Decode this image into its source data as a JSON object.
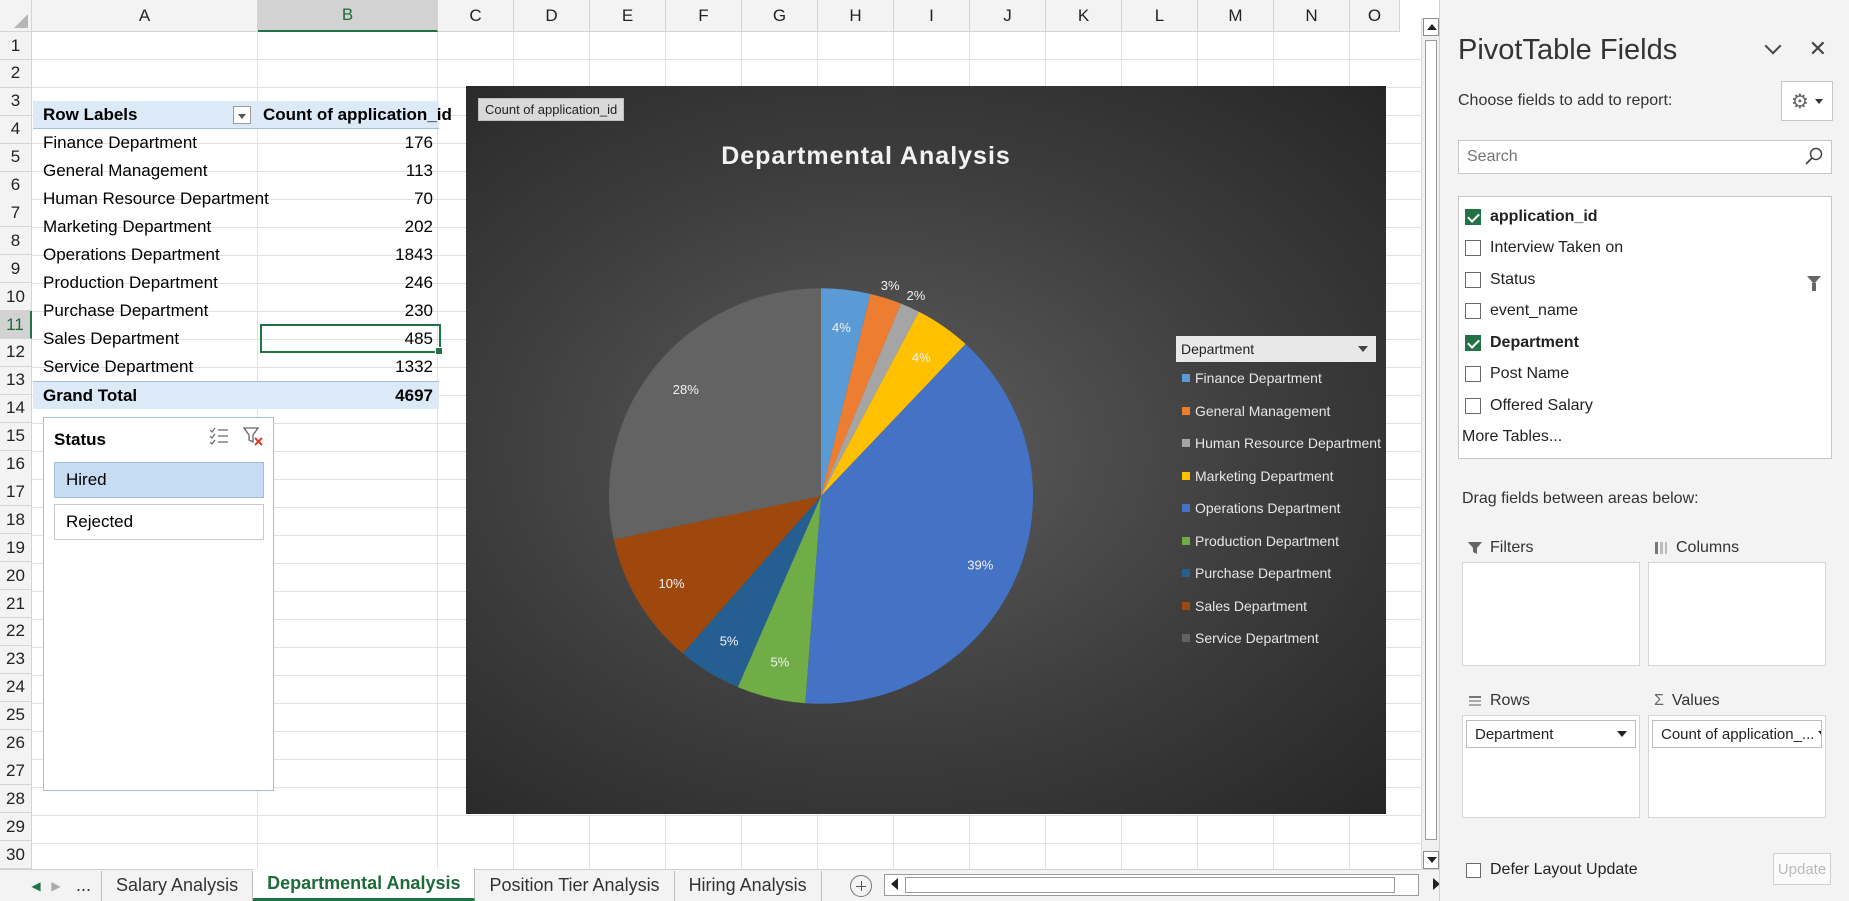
{
  "sheet": {
    "columns": [
      "A",
      "B",
      "C",
      "D",
      "E",
      "F",
      "G",
      "H",
      "I",
      "J",
      "K",
      "L",
      "M",
      "N",
      "O"
    ],
    "selected_column": "B",
    "rows": [
      "1",
      "2",
      "3",
      "4",
      "5",
      "6",
      "7",
      "8",
      "9",
      "10",
      "11",
      "12",
      "13",
      "14",
      "15",
      "16",
      "17",
      "18",
      "19",
      "20",
      "21",
      "22",
      "23",
      "24",
      "25",
      "26",
      "27",
      "28",
      "29",
      "30"
    ],
    "selected_row": "11"
  },
  "pivot": {
    "header_label": "Row Labels",
    "header_value": "Count of application_id",
    "rows": [
      {
        "label": "Finance Department",
        "value": "176"
      },
      {
        "label": "General Management",
        "value": "113"
      },
      {
        "label": "Human Resource Department",
        "value": "70"
      },
      {
        "label": "Marketing Department",
        "value": "202"
      },
      {
        "label": "Operations Department",
        "value": "1843"
      },
      {
        "label": "Production Department",
        "value": "246"
      },
      {
        "label": "Purchase Department",
        "value": "230"
      },
      {
        "label": "Sales Department",
        "value": "485"
      },
      {
        "label": "Service Department",
        "value": "1332"
      }
    ],
    "total_label": "Grand Total",
    "total_value": "4697"
  },
  "slicer": {
    "title": "Status",
    "items": [
      {
        "label": "Hired",
        "selected": true
      },
      {
        "label": "Rejected",
        "selected": false
      }
    ]
  },
  "chart_data": {
    "type": "pie",
    "title": "Departmental Analysis",
    "value_field_button": "Count of application_id",
    "legend_title": "Department",
    "legend_position": "right",
    "categories": [
      "Finance Department",
      "General Management",
      "Human Resource Department",
      "Marketing Department",
      "Operations Department",
      "Production Department",
      "Purchase Department",
      "Sales Department",
      "Service Department"
    ],
    "values": [
      176,
      113,
      70,
      202,
      1843,
      246,
      230,
      485,
      1332
    ],
    "labels": [
      "4%",
      "3%",
      "2%",
      "4%",
      "39%",
      "5%",
      "5%",
      "10%",
      "28%"
    ],
    "colors": [
      "#5b9bd5",
      "#ed7d31",
      "#a5a5a5",
      "#ffc000",
      "#4472c4",
      "#70ad47",
      "#255e91",
      "#9e480e",
      "#636363"
    ]
  },
  "tabs": {
    "ellipsis": "...",
    "items": [
      {
        "label": "Salary Analysis",
        "active": false
      },
      {
        "label": "Departmental Analysis",
        "active": true
      },
      {
        "label": "Position Tier Analysis",
        "active": false
      },
      {
        "label": "Hiring Analysis",
        "active": false
      }
    ]
  },
  "pane": {
    "title": "PivotTable Fields",
    "close": "✕",
    "choose_label": "Choose fields to add to report:",
    "search_placeholder": "Search",
    "fields": [
      {
        "label": "application_id",
        "checked": true,
        "filtered": false
      },
      {
        "label": "Interview Taken on",
        "checked": false,
        "filtered": false
      },
      {
        "label": "Status",
        "checked": false,
        "filtered": true
      },
      {
        "label": "event_name",
        "checked": false,
        "filtered": false
      },
      {
        "label": "Department",
        "checked": true,
        "filtered": false
      },
      {
        "label": "Post Name",
        "checked": false,
        "filtered": false
      },
      {
        "label": "Offered Salary",
        "checked": false,
        "filtered": false
      }
    ],
    "more_tables": "More Tables...",
    "drag_label": "Drag fields between areas below:",
    "filters_label": "Filters",
    "columns_label": "Columns",
    "rows_label": "Rows",
    "values_label": "Values",
    "rows_chip": "Department",
    "values_chip": "Count of application_...",
    "defer_label": "Defer Layout Update",
    "update_label": "Update"
  }
}
